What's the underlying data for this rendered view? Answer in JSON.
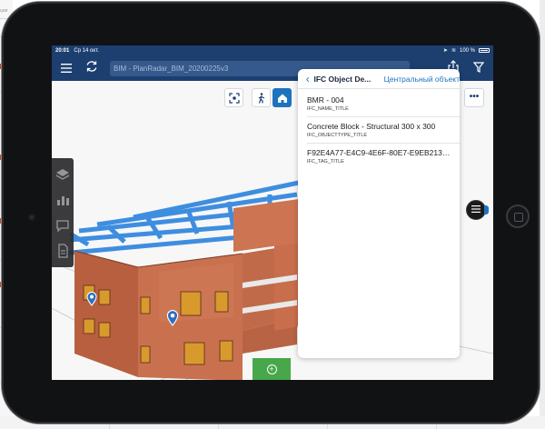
{
  "statusbar": {
    "time": "20:01",
    "date": "Ср 14 окт.",
    "battery": "100 %"
  },
  "navbar": {
    "title": "BIM - PlanRadar_BIM_20200225v3",
    "icons": [
      "hamburger-menu-icon",
      "sync-icon",
      "share-icon",
      "filter-icon"
    ]
  },
  "viewer": {
    "buttons": [
      "fit-view-icon",
      "walk-mode-icon",
      "home-view-icon"
    ],
    "side_tools": [
      "layers-icon",
      "chart-icon",
      "comment-icon",
      "document-icon"
    ],
    "add_button": "+",
    "more_button": "•••"
  },
  "ifc_panel": {
    "title": "IFC Object De...",
    "link": "Центральный объект",
    "items": [
      {
        "value": "BMR - 004",
        "key": "IFC_NAME_TITLE"
      },
      {
        "value": "Concrete Block - Structural 300 x 300",
        "key": "IFC_OBJECTTYPE_TITLE"
      },
      {
        "value": "F92E4A77-E4C9-4E6F-80E7-E9EB213D...",
        "key": "IFC_TAG_TITLE"
      }
    ]
  },
  "colors": {
    "navbar": "#1c3f70",
    "accent": "#1e73be",
    "add_button": "#47a74a",
    "brick": "#c9714f",
    "steel": "#3e8ee0"
  }
}
